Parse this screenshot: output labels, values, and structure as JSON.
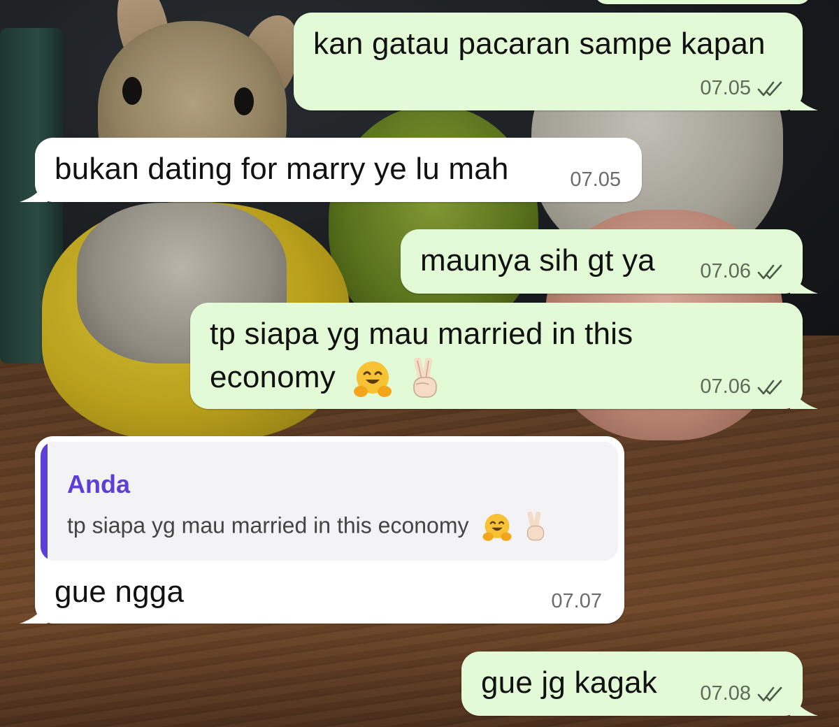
{
  "colors": {
    "outgoing_bubble": "#e2fbd6",
    "incoming_bubble": "#ffffff",
    "quote_accent": "#5b3fd6",
    "read_ticks": "#4a5a48"
  },
  "icons": {
    "read_receipt": "double-check-icon",
    "hug_emoji": "hugging-face-emoji",
    "peace_emoji": "victory-hand-emoji"
  },
  "messages": [
    {
      "direction": "outgoing",
      "text": "kan gatau pacaran sampe kapan",
      "time": "07.05",
      "status": "read"
    },
    {
      "direction": "incoming",
      "text": "bukan dating for marry ye lu mah",
      "time": "07.05"
    },
    {
      "direction": "outgoing",
      "text": "maunya sih gt ya",
      "time": "07.06",
      "status": "read"
    },
    {
      "direction": "outgoing",
      "text_line1": "tp siapa yg mau married in this",
      "text_line2": "economy",
      "time": "07.06",
      "status": "read"
    },
    {
      "direction": "incoming",
      "quote": {
        "author": "Anda",
        "text": "tp siapa yg mau married in this economy"
      },
      "text": "gue ngga",
      "time": "07.07"
    },
    {
      "direction": "outgoing",
      "text": "gue jg kagak",
      "time": "07.08",
      "status": "read"
    }
  ]
}
